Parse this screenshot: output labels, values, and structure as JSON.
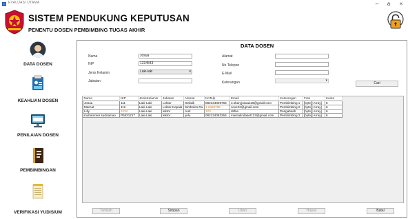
{
  "window": {
    "title": "EVALUASI UTAMA",
    "minimize": "–",
    "maximize": "a",
    "close": "×"
  },
  "header": {
    "title": "SISTEM PENDUKUNG KEPUTUSAN",
    "subtitle": "PENENTU DOSEN PEMBIMBING TUGAS AKHIR"
  },
  "sidebar": {
    "items": [
      {
        "label": "DATA DOSEN",
        "icon": "user-avatar-icon"
      },
      {
        "label": "KEAHLIAN DOSEN",
        "icon": "id-card-icon"
      },
      {
        "label": "PENILAIAN DOSEN",
        "icon": "monitor-icon"
      },
      {
        "label": "PEMBIMBINGAN",
        "icon": "notebook-icon"
      },
      {
        "label": "VERIFIKASI YUDISIUM",
        "icon": "notepad-icon"
      }
    ]
  },
  "form": {
    "title": "DATA DOSEN",
    "nama": {
      "label": "Nama",
      "value": "Josua"
    },
    "nip": {
      "label": "NIP",
      "value": "1234543"
    },
    "jenis_kelamin": {
      "label": "Jenis Kelamin",
      "value": "Laki-laki"
    },
    "jabatan": {
      "label": "Jabatan",
      "value": ""
    },
    "alamat": {
      "label": "Alamat",
      "value": ""
    },
    "no_telepon": {
      "label": "No Telepon",
      "value": ""
    },
    "email": {
      "label": "E-Mail",
      "value": ""
    },
    "keterangan": {
      "label": "Keterangan",
      "value": ""
    },
    "cari_label": "Cari"
  },
  "table": {
    "columns": [
      "Nama",
      "NIP",
      "JenisKelamin",
      "Jabatan",
      "Alamat",
      "NoTelp",
      "Email",
      "Keterangan",
      "Foto",
      "Kuota"
    ],
    "rows": [
      [
        "Josua",
        "111",
        "Laki-Laki",
        "Lektor",
        "Gelatik",
        "082134029765",
        "o.sharyjosua116@gmail.com",
        "Pembimbing 1",
        "[byte[] Array]",
        "5"
      ],
      [
        "Marnat",
        "112",
        "Laki-Laki",
        "Lektor Kepala",
        "Simbolon.Ru",
        "1.2456789",
        "cevertz@gmail.com",
        "Pembimbing 2",
        "[byte[] Array]",
        "6"
      ],
      [
        "Lilly",
        "1234",
        "Laki-Laki",
        "lektor",
        "cust",
        "123",
        "dsfrw",
        "Pengabsah",
        "[byte[] Array]",
        "6"
      ],
      [
        "muhammer sudiraman",
        "P5531217",
        "Laki-Laki",
        "lektor",
        "yelu",
        "082134053256",
        "marnatindaset123@gmail.com",
        "Pembimbing 2",
        "[byte[] Array]",
        "6"
      ]
    ]
  },
  "buttons": {
    "tambah": "Tambah",
    "simpan": "Simpan",
    "ubah": "Ubah",
    "hapus": "Hapus",
    "batal": "Batal"
  }
}
